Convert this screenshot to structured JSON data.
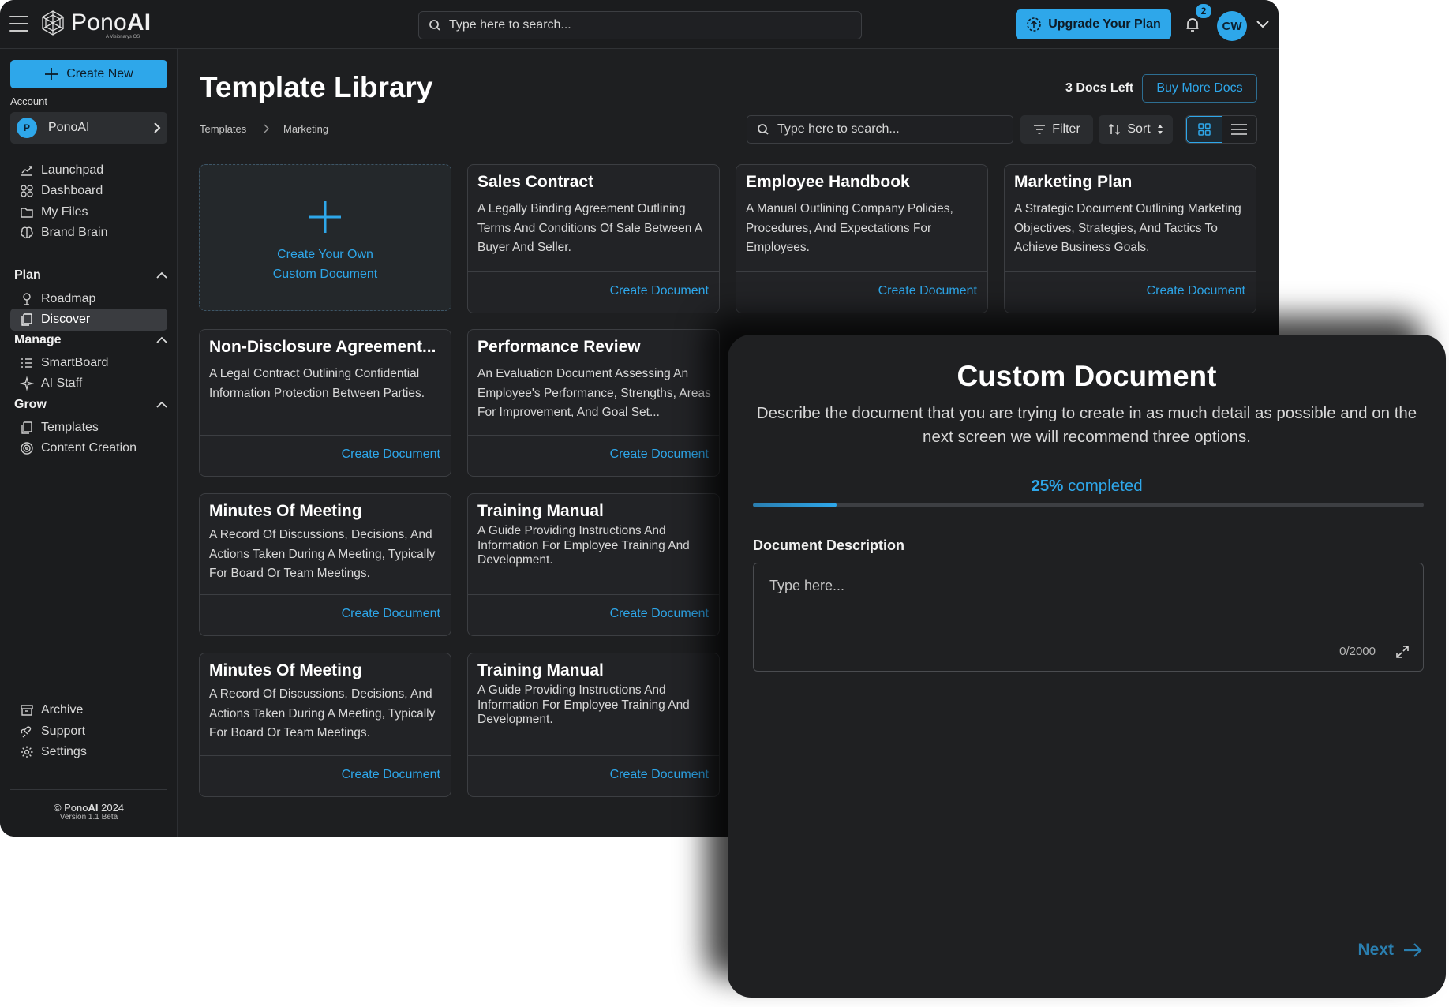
{
  "topbar": {
    "brand_prefix": "Pono",
    "brand_suffix": "AI",
    "brand_tagline": "A Visionarys OS",
    "search_placeholder": "Type here to search...",
    "upgrade_label": "Upgrade Your Plan",
    "notification_count": "2",
    "user_initials": "CW"
  },
  "sidebar": {
    "create_new_label": "Create New",
    "account_label": "Account",
    "account_initial": "P",
    "account_name": "PonoAI",
    "items_top": [
      {
        "label": "Launchpad",
        "icon": "launchpad-icon"
      },
      {
        "label": "Dashboard",
        "icon": "dashboard-icon"
      },
      {
        "label": "My Files",
        "icon": "folder-icon"
      },
      {
        "label": "Brand Brain",
        "icon": "brain-icon"
      }
    ],
    "sections": [
      {
        "title": "Plan",
        "items": [
          {
            "label": "Roadmap",
            "icon": "roadmap-icon"
          },
          {
            "label": "Discover",
            "icon": "discover-icon",
            "active": true
          }
        ]
      },
      {
        "title": "Manage",
        "items": [
          {
            "label": "SmartBoard",
            "icon": "smartboard-icon"
          },
          {
            "label": "AI Staff",
            "icon": "sparkle-icon"
          }
        ]
      },
      {
        "title": "Grow",
        "items": [
          {
            "label": "Templates",
            "icon": "templates-icon"
          },
          {
            "label": "Content Creation",
            "icon": "content-icon"
          }
        ]
      }
    ],
    "items_bottom": [
      {
        "label": "Archive",
        "icon": "archive-icon"
      },
      {
        "label": "Support",
        "icon": "support-icon"
      },
      {
        "label": "Settings",
        "icon": "gear-icon"
      }
    ],
    "copyright_prefix": "© Pono",
    "copyright_brand": "AI",
    "copyright_year": " 2024",
    "version": "Version 1.1 Beta"
  },
  "main": {
    "title": "Template Library",
    "docs_left": "3 Docs Left",
    "buy_more_label": "Buy More Docs",
    "breadcrumb": [
      "Templates",
      "Marketing"
    ],
    "search_placeholder": "Type here to search...",
    "filter_label": "Filter",
    "sort_label": "Sort",
    "custom_card_line1": "Create Your Own",
    "custom_card_line2": "Custom Document",
    "card_action": "Create Document",
    "cards": [
      {
        "title": "Sales Contract",
        "desc": "A Legally Binding Agreement Outlining Terms And Conditions Of Sale Between A Buyer And Seller."
      },
      {
        "title": "Employee Handbook",
        "desc": "A Manual Outlining Company Policies, Procedures, And Expectations For Employees."
      },
      {
        "title": "Marketing Plan",
        "desc": "A Strategic Document Outlining Marketing Objectives, Strategies, And Tactics To Achieve Business Goals."
      },
      {
        "title": "Non-Disclosure Agreement...",
        "desc": "A Legal Contract Outlining Confidential Information Protection Between Parties."
      },
      {
        "title": "Performance Review",
        "desc": "An Evaluation Document Assessing An Employee's Performance, Strengths, Areas For Improvement, And Goal Set..."
      },
      {
        "title": "Minutes Of Meeting",
        "desc": "A Record Of Discussions, Decisions, And Actions Taken During A Meeting, Typically For Board Or Team Meetings."
      },
      {
        "title": "Training Manual",
        "desc": "A Guide Providing Instructions And Information For Employee Training And Development."
      },
      {
        "title": "Minutes Of Meeting",
        "desc": "A Record Of Discussions, Decisions, And Actions Taken During A Meeting, Typically For Board Or Team Meetings."
      },
      {
        "title": "Training Manual",
        "desc": "A Guide Providing Instructions And Information For Employee Training And Development."
      }
    ]
  },
  "modal": {
    "title": "Custom Document",
    "description": "Describe the document that you are trying to create in as much detail as possible and on the next screen we will recommend three options.",
    "progress_percent": "25%",
    "progress_suffix": " completed",
    "progress_value": 0.25,
    "field_label": "Document Description",
    "field_placeholder": "Type here...",
    "counter": "0/2000",
    "next_label": "Next"
  },
  "colors": {
    "accent": "#2ea7ea",
    "background": "#1e1f21",
    "card_border": "#3c3e42"
  }
}
